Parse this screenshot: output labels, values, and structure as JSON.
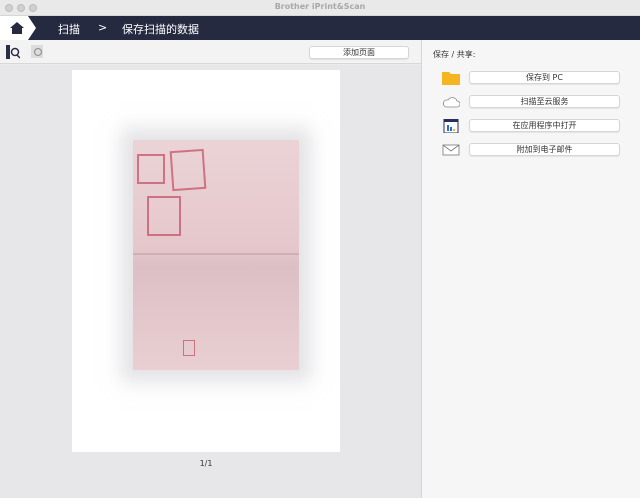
{
  "window": {
    "title": "Brother iPrint&Scan"
  },
  "nav": {
    "crumb1": "扫描",
    "separator": ">",
    "crumb2": "保存扫描的数据"
  },
  "toolbar": {
    "add_page": "添加页面"
  },
  "preview": {
    "page_indicator": "1/1"
  },
  "share": {
    "label": "保存 / 共享:",
    "actions": [
      {
        "label": "保存到 PC",
        "icon": "folder-icon"
      },
      {
        "label": "扫描至云服务",
        "icon": "cloud-icon"
      },
      {
        "label": "在应用程序中打开",
        "icon": "app-icon"
      },
      {
        "label": "附加到电子邮件",
        "icon": "mail-icon"
      }
    ]
  },
  "colors": {
    "nav": "#262a40",
    "folder": "#f5b521"
  }
}
